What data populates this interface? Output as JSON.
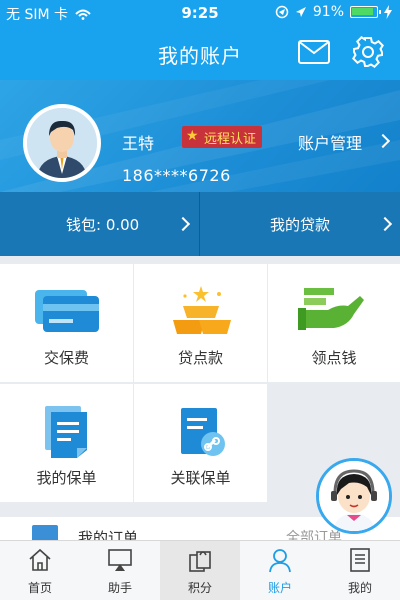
{
  "status_bar": {
    "carrier": "无 SIM 卡",
    "time": "9:25",
    "battery": "91%",
    "battery_level": 0.91
  },
  "nav": {
    "title": "我的账户",
    "mail_icon": "mail-icon",
    "settings_icon": "gear-icon"
  },
  "profile": {
    "name": "王特",
    "badge": "远程认证",
    "account_management": "账户管理",
    "phone": "186****6726"
  },
  "wallet_row": {
    "wallet": "钱包: 0.00",
    "loans": "我的贷款"
  },
  "grid": [
    {
      "label": "交保费",
      "icon": "card-payment-icon"
    },
    {
      "label": "贷点款",
      "icon": "gold-bars-icon"
    },
    {
      "label": "领点钱",
      "icon": "cash-hand-icon"
    },
    {
      "label": "我的保单",
      "icon": "policy-document-icon"
    },
    {
      "label": "关联保单",
      "icon": "linked-policy-icon"
    }
  ],
  "orders": {
    "title": "我的订单",
    "all": "全部订单"
  },
  "tabs": [
    {
      "label": "首页",
      "icon": "home-icon"
    },
    {
      "label": "助手",
      "icon": "airplay-icon"
    },
    {
      "label": "积分",
      "icon": "shopping-bag-icon"
    },
    {
      "label": "账户",
      "icon": "person-icon"
    },
    {
      "label": "我的",
      "icon": "document-list-icon"
    }
  ],
  "colors": {
    "brand": "#19a3ee",
    "wallet_bar": "#1a77b5",
    "tab_active": "#1e9ee6",
    "badge_bg": "#c8323a"
  }
}
